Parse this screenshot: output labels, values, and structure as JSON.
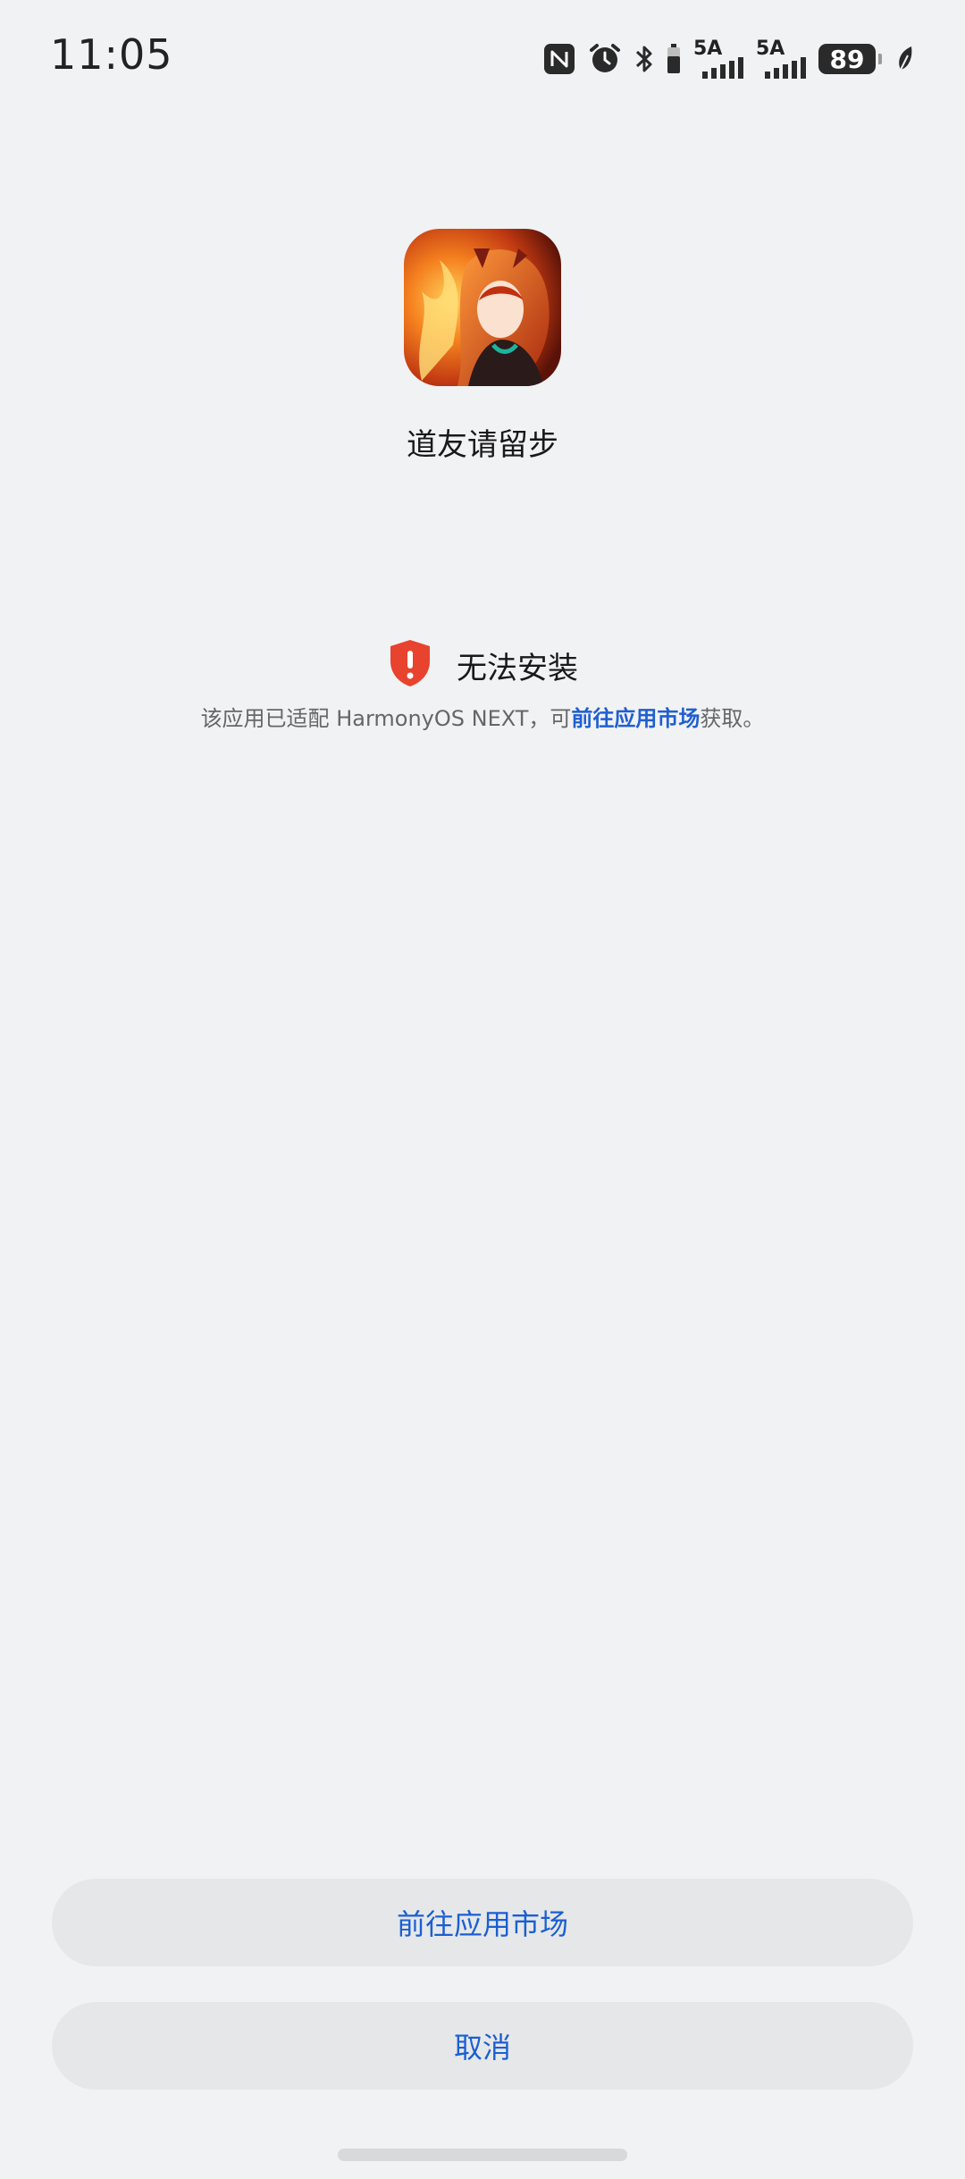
{
  "status_bar": {
    "time": "11:05",
    "network1": "5A",
    "network2": "5A",
    "battery": "89"
  },
  "app": {
    "name": "道友请留步"
  },
  "warning": {
    "title": "无法安装",
    "desc_prefix": "该应用已适配 HarmonyOS NEXT，可",
    "desc_link": "前往应用市场",
    "desc_suffix": "获取。",
    "color": "#e8432e"
  },
  "buttons": {
    "market_label": "前往应用市场",
    "cancel_label": "取消"
  },
  "colors": {
    "accent": "#1a5fd2",
    "background": "#f1f2f4",
    "button_bg": "#e6e7e9"
  }
}
